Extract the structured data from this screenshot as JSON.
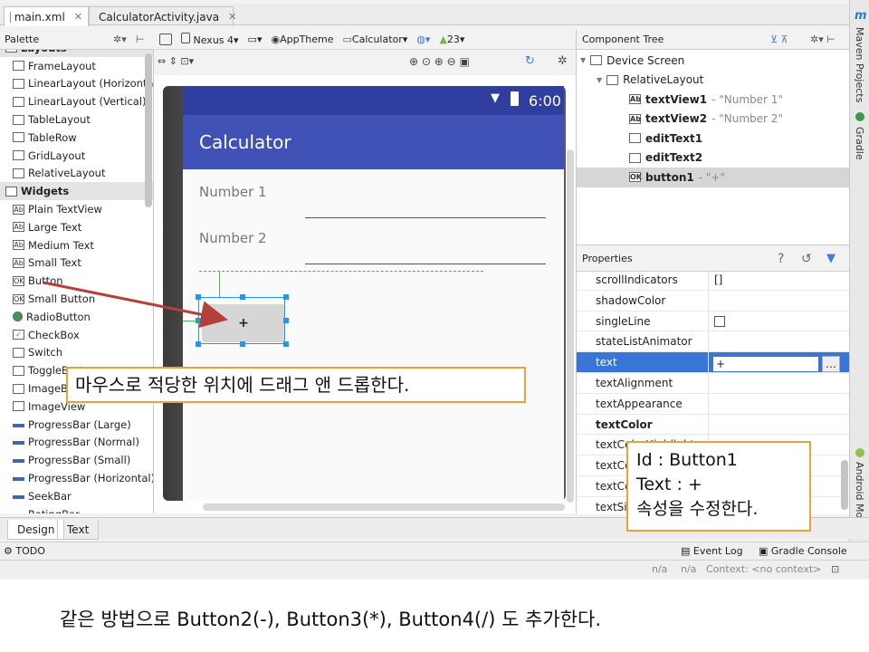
{
  "editor_tabs": [
    {
      "label": "main.xml",
      "active": true
    },
    {
      "label": "CalculatorActivity.java",
      "active": false
    }
  ],
  "right_strip": {
    "maven": "Maven Projects",
    "gradle": "Gradle",
    "android_model": "Android Model",
    "m_label": "m"
  },
  "palette": {
    "title": "Palette",
    "items": [
      {
        "label": "Layouts",
        "group": true
      },
      {
        "label": "FrameLayout"
      },
      {
        "label": "LinearLayout (Horizontal)"
      },
      {
        "label": "LinearLayout (Vertical)"
      },
      {
        "label": "TableLayout"
      },
      {
        "label": "TableRow"
      },
      {
        "label": "GridLayout"
      },
      {
        "label": "RelativeLayout"
      },
      {
        "label": "Widgets",
        "group": true
      },
      {
        "label": "Plain TextView"
      },
      {
        "label": "Large Text"
      },
      {
        "label": "Medium Text"
      },
      {
        "label": "Small Text"
      },
      {
        "label": "Button"
      },
      {
        "label": "Small Button"
      },
      {
        "label": "RadioButton"
      },
      {
        "label": "CheckBox"
      },
      {
        "label": "Switch"
      },
      {
        "label": "ToggleButton"
      },
      {
        "label": "ImageButton"
      },
      {
        "label": "ImageView"
      },
      {
        "label": "ProgressBar (Large)"
      },
      {
        "label": "ProgressBar (Normal)"
      },
      {
        "label": "ProgressBar (Small)"
      },
      {
        "label": "ProgressBar (Horizontal)"
      },
      {
        "label": "SeekBar"
      },
      {
        "label": "RatingBar"
      }
    ]
  },
  "toolbar": {
    "device": "Nexus 4",
    "theme": "AppTheme",
    "activity": "Calculator",
    "api": "23"
  },
  "phone": {
    "time": "6:00",
    "app_title": "Calculator",
    "hint1": "Number 1",
    "hint2": "Number 2",
    "button_text": "+"
  },
  "component_tree": {
    "title": "Component Tree",
    "items": [
      {
        "label": "Device Screen",
        "extra": ""
      },
      {
        "label": "RelativeLayout",
        "extra": ""
      },
      {
        "label": "textView1",
        "extra": " - \"Number 1\""
      },
      {
        "label": "textView2",
        "extra": " - \"Number 2\""
      },
      {
        "label": "editText1",
        "extra": ""
      },
      {
        "label": "editText2",
        "extra": ""
      },
      {
        "label": "button1",
        "extra": " - \"+\""
      }
    ]
  },
  "properties": {
    "title": "Properties",
    "rows": [
      {
        "name": "scrollIndicators",
        "value": "[]"
      },
      {
        "name": "shadowColor",
        "value": ""
      },
      {
        "name": "singleLine",
        "value": ""
      },
      {
        "name": "stateListAnimator",
        "value": ""
      },
      {
        "name": "text",
        "value": "+"
      },
      {
        "name": "textAlignment",
        "value": ""
      },
      {
        "name": "textAppearance",
        "value": ""
      },
      {
        "name": "textColor",
        "value": ""
      },
      {
        "name": "textColorHighlight",
        "value": ""
      },
      {
        "name": "textColorHint",
        "value": ""
      },
      {
        "name": "textColorLink",
        "value": ""
      },
      {
        "name": "textSize",
        "value": ""
      }
    ]
  },
  "bottom_tabs": {
    "design": "Design",
    "text": "Text"
  },
  "tool_windows": {
    "todo": "TODO",
    "event_log": "Event Log",
    "gradle_console": "Gradle Console"
  },
  "status": {
    "na1": "n/a",
    "na2": "n/a",
    "context": "Context: <no context>"
  },
  "callouts": {
    "drag": "마우스로 적당한 위치에 드래그 앤 드롭한다.",
    "id_line": "Id  : Button1",
    "text_line": "Text : +",
    "edit_line": "속성을 수정한다."
  },
  "caption": "같은 방법으로 Button2(-), Button3(*), Button4(/) 도 추가한다."
}
